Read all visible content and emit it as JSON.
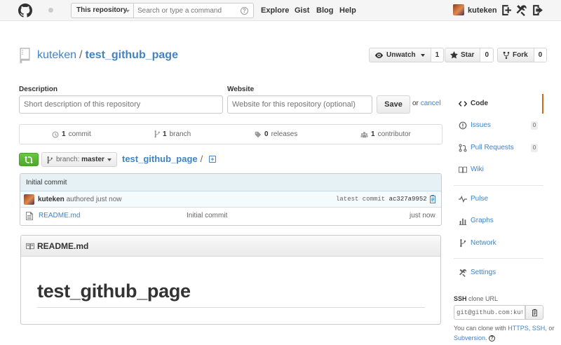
{
  "header": {
    "scope_label": "This repository",
    "search_placeholder": "Search or type a command",
    "help_glyph": "?",
    "nav": [
      "Explore",
      "Gist",
      "Blog",
      "Help"
    ],
    "username": "kuteken"
  },
  "repo": {
    "owner": "kuteken",
    "separator": "/",
    "name": "test_github_page",
    "watch_label": "Unwatch",
    "watch_count": "1",
    "star_label": "Star",
    "star_count": "0",
    "fork_label": "Fork",
    "fork_count": "0"
  },
  "form": {
    "description_label": "Description",
    "description_placeholder": "Short description of this repository",
    "website_label": "Website",
    "website_placeholder": "Website for this repository (optional)",
    "save_label": "Save",
    "or_text": "or",
    "cancel_label": "cancel"
  },
  "stats": {
    "commits_num": "1",
    "commits_label": "commit",
    "branches_num": "1",
    "branches_label": "branch",
    "releases_num": "0",
    "releases_label": "releases",
    "contributors_num": "1",
    "contributors_label": "contributor"
  },
  "branch": {
    "prefix": "branch:",
    "name": "master",
    "crumb": "test_github_page",
    "slash": "/",
    "add_glyph": "+"
  },
  "commit": {
    "title": "Initial commit",
    "author": "kuteken",
    "authored_text": "authored just now",
    "latest_label": "latest commit",
    "sha": "ac327a9952"
  },
  "files": [
    {
      "name": "README.md",
      "message": "Initial commit",
      "age": "just now"
    }
  ],
  "readme": {
    "header": "README.md",
    "heading": "test_github_page"
  },
  "sidebar": {
    "items": [
      {
        "label": "Code",
        "icon": "code-icon"
      },
      {
        "label": "Issues",
        "icon": "issue-icon",
        "badge": "0"
      },
      {
        "label": "Pull Requests",
        "icon": "pull-request-icon",
        "badge": "0"
      },
      {
        "label": "Wiki",
        "icon": "book-icon"
      },
      {
        "label": "Pulse",
        "icon": "pulse-icon"
      },
      {
        "label": "Graphs",
        "icon": "graph-icon"
      },
      {
        "label": "Network",
        "icon": "network-icon"
      },
      {
        "label": "Settings",
        "icon": "tools-icon"
      }
    ],
    "ssh_label": "SSH",
    "clone_url_label": "clone URL",
    "ssh_url": "git@github.com:kuteken/test_github_page.git",
    "clone_text_1": "You can clone with",
    "https_label": "HTTPS",
    "comma": ",",
    "ssh_link": "SSH",
    "or_text": ", or",
    "subversion_label": "Subversion",
    "period": ".",
    "help_glyph": "?"
  },
  "colors": {
    "link": "#4183c4",
    "active_tab": "#d26911",
    "compare_green": "#6cc644",
    "commit_bar": "#e6f1f6"
  }
}
